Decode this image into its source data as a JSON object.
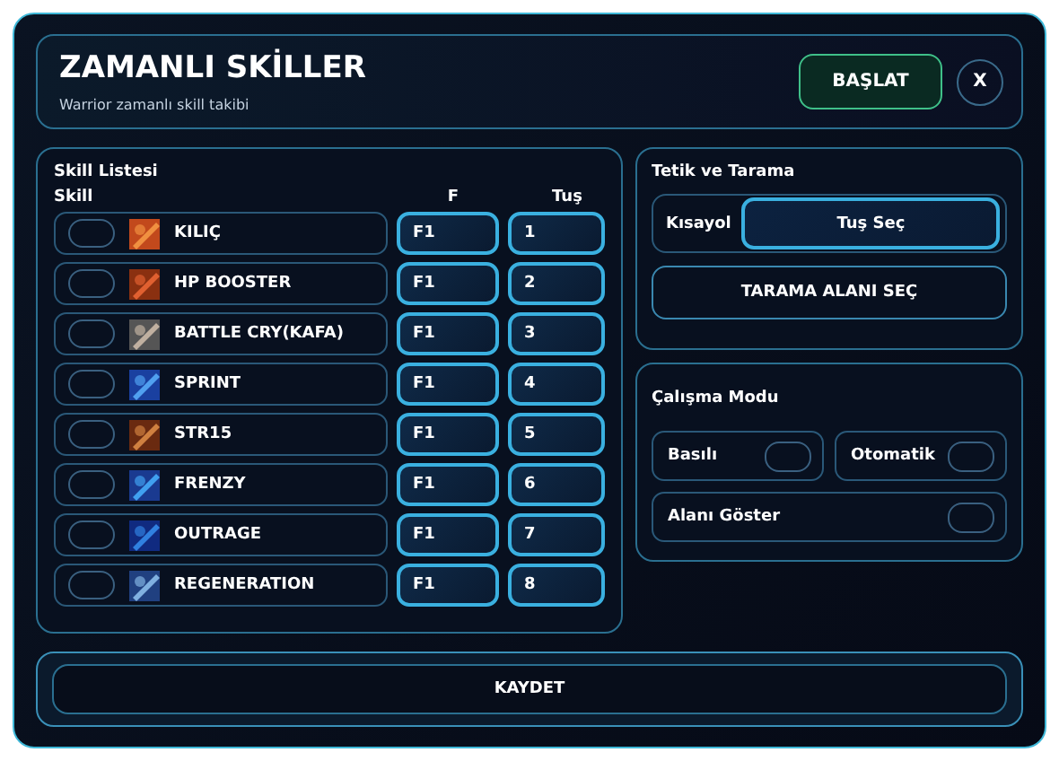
{
  "header": {
    "title": "ZAMANLI SKİLLER",
    "subtitle": "Warrior zamanlı skill takibi",
    "start_button": "BAŞLAT",
    "close_button": "X"
  },
  "skill_list": {
    "title": "Skill Listesi",
    "columns": [
      "Skill",
      "F",
      "Tuş"
    ],
    "rows": [
      {
        "name": "KILIÇ",
        "checked": false,
        "f": "F1",
        "key": "1"
      },
      {
        "name": "HP BOOSTER",
        "checked": false,
        "f": "F1",
        "key": "2"
      },
      {
        "name": "BATTLE CRY(KAFA)",
        "checked": false,
        "f": "F1",
        "key": "3"
      },
      {
        "name": "SPRINT",
        "checked": false,
        "f": "F1",
        "key": "4"
      },
      {
        "name": "STR15",
        "checked": false,
        "f": "F1",
        "key": "5"
      },
      {
        "name": "FRENZY",
        "checked": false,
        "f": "F1",
        "key": "6"
      },
      {
        "name": "OUTRAGE",
        "checked": false,
        "f": "F1",
        "key": "7"
      },
      {
        "name": "REGENERATION",
        "checked": false,
        "f": "F1",
        "key": "8"
      }
    ]
  },
  "trigger": {
    "title": "Tetik ve Tarama",
    "shortcut_label": "Kısayol",
    "shortcut_button": "Tuş Seç",
    "scan_button": "TARAMA ALANI SEÇ"
  },
  "mode": {
    "title": "Çalışma Modu",
    "toggles": [
      {
        "label": "Basılı",
        "on": false
      },
      {
        "label": "Otomatik",
        "on": false
      },
      {
        "label": "Alanı Göster",
        "on": false
      }
    ]
  },
  "save_button": "KAYDET"
}
